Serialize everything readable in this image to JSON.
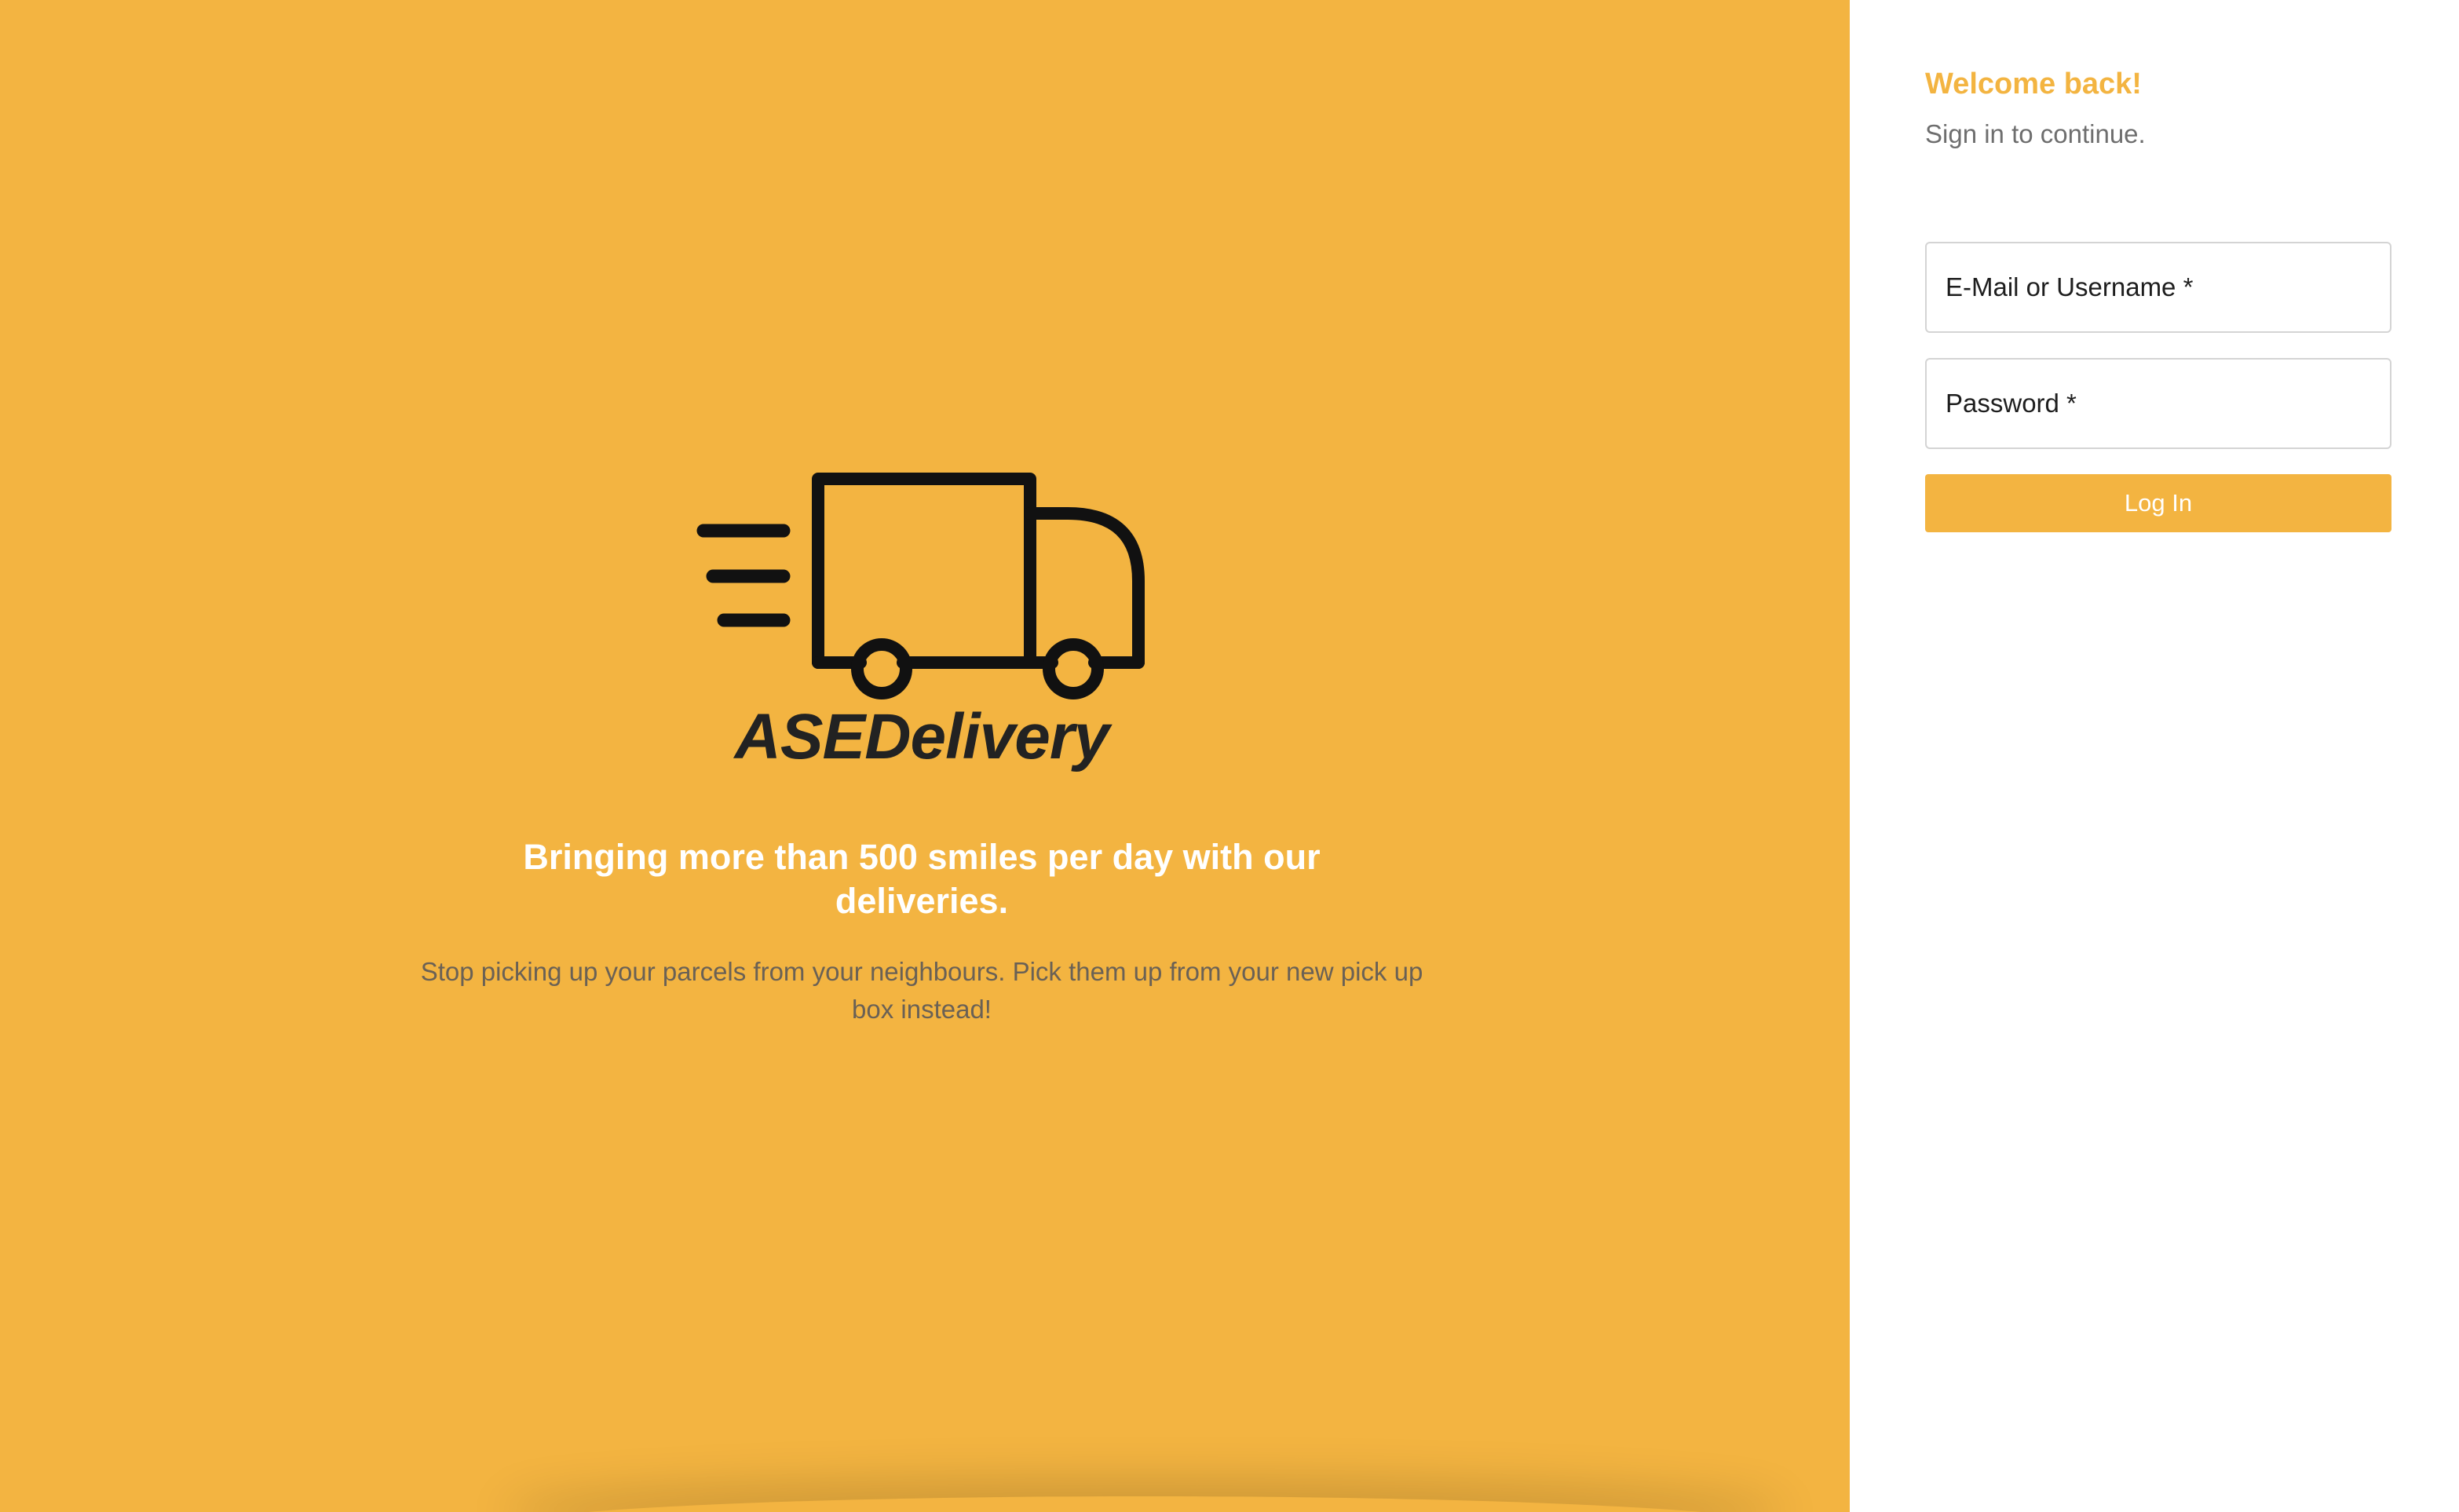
{
  "hero": {
    "brand_name": "ASEDelivery",
    "logo_icon": "delivery-truck-icon",
    "tagline": "Bringing more than 500 smiles per day with our deliveries.",
    "subline": "Stop picking up your parcels from your neighbours. Pick them up from your new pick up box instead!",
    "background_color": "#F3B441"
  },
  "login": {
    "welcome": "Welcome back!",
    "subtitle": "Sign in to continue.",
    "email_placeholder": "E-Mail or Username *",
    "password_placeholder": "Password *",
    "login_label": "Log In",
    "accent_color": "#F3B441"
  }
}
